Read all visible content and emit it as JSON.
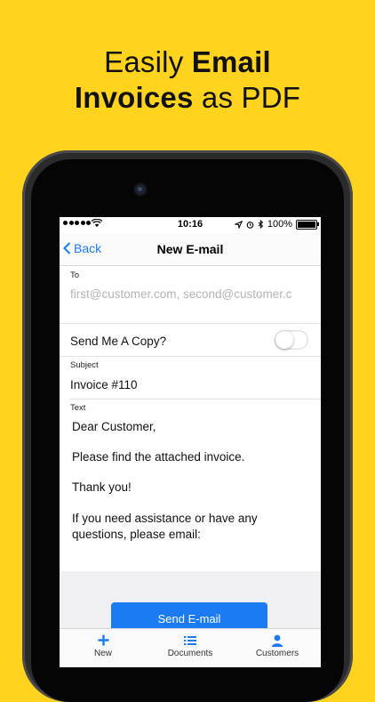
{
  "headline": {
    "line1_plain": "Easily ",
    "line1_bold": "Email",
    "line2_bold": "Invoices",
    "line2_plain": " as PDF"
  },
  "status_bar": {
    "time": "10:16",
    "battery": "100%"
  },
  "nav": {
    "back_label": "Back",
    "title": "New E-mail"
  },
  "form": {
    "to": {
      "label": "To",
      "placeholder": "first@customer.com, second@customer.c"
    },
    "send_copy": {
      "label": "Send Me A Copy?",
      "enabled": false
    },
    "subject": {
      "label": "Subject",
      "value": "Invoice #110"
    },
    "text": {
      "label": "Text",
      "lines": [
        "Dear Customer,",
        "Please find the attached invoice.",
        "Thank you!",
        "If you need assistance or have any",
        "questions, please email:"
      ]
    }
  },
  "send_button": "Send E-mail",
  "tabs": [
    {
      "label": "New",
      "icon": "plus-icon"
    },
    {
      "label": "Documents",
      "icon": "list-icon"
    },
    {
      "label": "Customers",
      "icon": "person-icon"
    }
  ],
  "colors": {
    "background": "#FFD31E",
    "accent": "#1B7CF2"
  }
}
